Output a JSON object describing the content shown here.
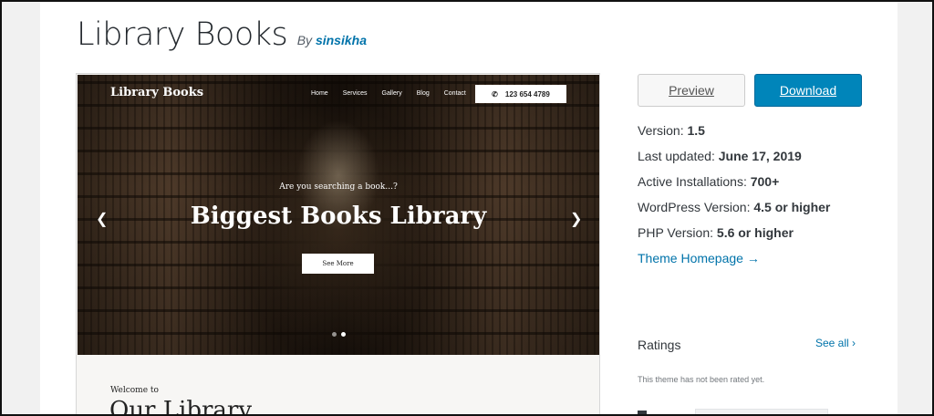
{
  "theme": {
    "title": "Library Books",
    "by_label": "By",
    "author": "sinsikha"
  },
  "preview_screenshot": {
    "site_logo": "Library Books",
    "nav": [
      "Home",
      "Services",
      "Gallery",
      "Blog",
      "Contact"
    ],
    "phone": "123 654 4789",
    "tagline": "Are you searching a book...?",
    "headline": "Biggest Books Library",
    "cta": "See More",
    "slider_dots": 2,
    "active_dot": 2,
    "welcome_small": "Welcome to",
    "welcome_big": "Our Library"
  },
  "actions": {
    "preview": "Preview",
    "download": "Download"
  },
  "meta": {
    "version_label": "Version:",
    "version": "1.5",
    "updated_label": "Last updated:",
    "updated": "June 17, 2019",
    "installs_label": "Active Installations:",
    "installs": "700+",
    "wp_label": "WordPress Version:",
    "wp": "4.5 or higher",
    "php_label": "PHP Version:",
    "php": "5.6 or higher",
    "homepage": "Theme Homepage →"
  },
  "ratings": {
    "title": "Ratings",
    "see_all": "See all",
    "empty": "This theme has not been rated yet."
  },
  "colors": {
    "link": "#0073aa",
    "download_bg": "#0085ba"
  }
}
